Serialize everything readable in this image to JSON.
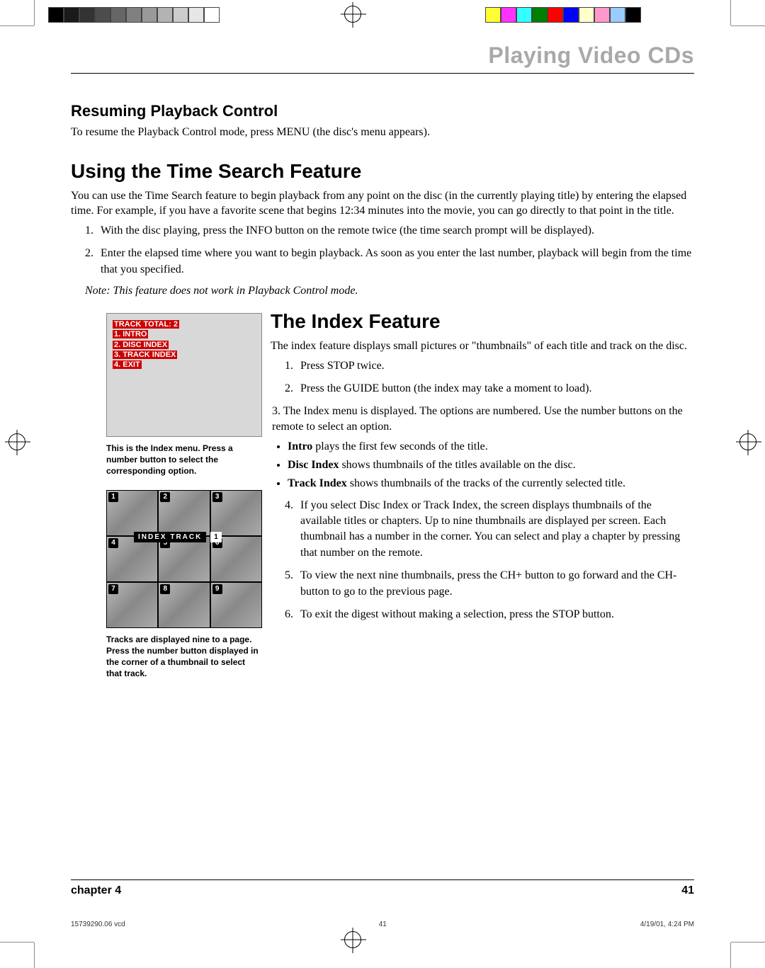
{
  "swatches_left": [
    "#000000",
    "#1a1a1a",
    "#333333",
    "#4d4d4d",
    "#666666",
    "#808080",
    "#999999",
    "#b3b3b3",
    "#cccccc",
    "#e6e6e6",
    "#ffffff"
  ],
  "swatches_right": [
    "#ffff33",
    "#ff33ff",
    "#33ffff",
    "#008000",
    "#ff0000",
    "#0000ff",
    "#ffffcc",
    "#ff99cc",
    "#99ccff",
    "#000000"
  ],
  "running_head": "Playing Video CDs",
  "sec1": {
    "title": "Resuming Playback Control",
    "body": "To resume the Playback Control mode, press MENU (the disc's menu appears)."
  },
  "sec2": {
    "title": "Using the Time Search Feature",
    "intro": "You can use the Time Search feature to begin playback from any point on the disc (in the currently playing title) by entering the elapsed time. For example, if you have a favorite scene that begins 12:34 minutes into the movie, you can go directly to that point in the title.",
    "steps": [
      "With the disc playing, press the INFO button on the remote twice (the time search prompt will be displayed).",
      "Enter the elapsed time where you want to begin playback. As soon as you enter the last number, playback will begin from the time that you specified."
    ],
    "note": "Note: This feature does not work in Playback Control mode."
  },
  "index_menu": {
    "lines": [
      "TRACK TOTAL: 2",
      "1. INTRO",
      "2. DISC INDEX",
      "3. TRACK INDEX",
      "4. EXIT"
    ]
  },
  "caption1": "This is the Index menu. Press a number button to select the corresponding option.",
  "thumb_label": "INDEX TRACK",
  "thumb_label_num": "1",
  "caption2": "Tracks are displayed nine to a page. Press the number button displayed in the corner of a thumbnail to select that track.",
  "sec3": {
    "title": "The Index Feature",
    "intro": "The index feature displays small pictures or \"thumbnails\" of each title and track on the disc.",
    "step1": "Press STOP twice.",
    "step2": "Press the GUIDE button (the index may take a moment to load).",
    "step3": "3. The Index menu is displayed. The options are numbered. Use the number buttons on the remote to select an option.",
    "bullets": {
      "intro_b": "Intro",
      "intro_t": " plays the first few seconds of  the title.",
      "disc_b": "Disc Index",
      "disc_t": " shows thumbnails of the titles available on the disc.",
      "track_b": "Track Index",
      "track_t": " shows thumbnails of the tracks of the currently selected title."
    },
    "step4": "If you select Disc Index or Track Index, the screen displays thumbnails of the available titles or chapters. Up to nine thumbnails are displayed per screen. Each thumbnail has a number in the corner. You can select and play a chapter by pressing that number on the remote.",
    "step5": "To view the next nine thumbnails, press the CH+ button to go forward and the CH- button to go to the previous page.",
    "step6": "To exit the digest without making a selection,  press the STOP button."
  },
  "footer": {
    "chapter": "chapter 4",
    "page": "41"
  },
  "slug": {
    "file": "15739290.06 vcd",
    "pg": "41",
    "ts": "4/19/01, 4:24 PM"
  }
}
